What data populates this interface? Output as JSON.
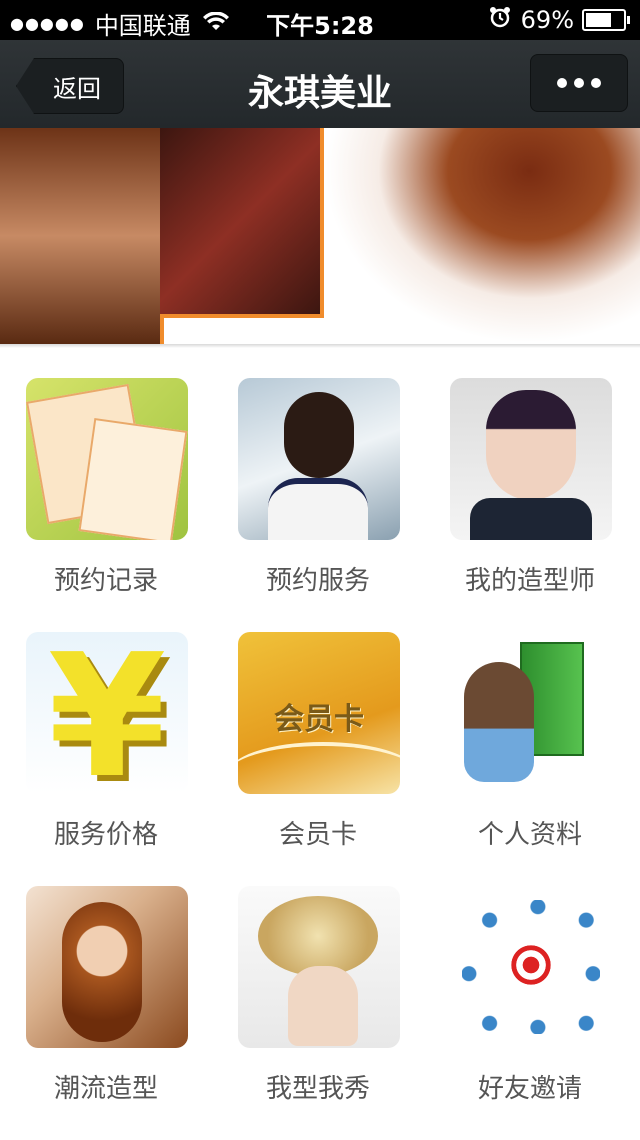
{
  "status_bar": {
    "signal": "●●●●●",
    "carrier": "中国联通",
    "time": "下午5:28",
    "battery_percent": "69%",
    "battery_level": 0.69
  },
  "nav": {
    "back_label": "返回",
    "title": "永琪美业",
    "more_icon": "more-dots-icon"
  },
  "grid": {
    "items": [
      {
        "label": "预约记录"
      },
      {
        "label": "预约服务"
      },
      {
        "label": "我的造型师"
      },
      {
        "label": "服务价格"
      },
      {
        "label": "会员卡",
        "card_text": "会员卡"
      },
      {
        "label": "个人资料"
      },
      {
        "label": "潮流造型"
      },
      {
        "label": "我型我秀"
      },
      {
        "label": "好友邀请"
      }
    ]
  },
  "colors": {
    "navbar": "#2f3437",
    "accent_orange": "#f08c2c",
    "label_text": "#555555"
  }
}
